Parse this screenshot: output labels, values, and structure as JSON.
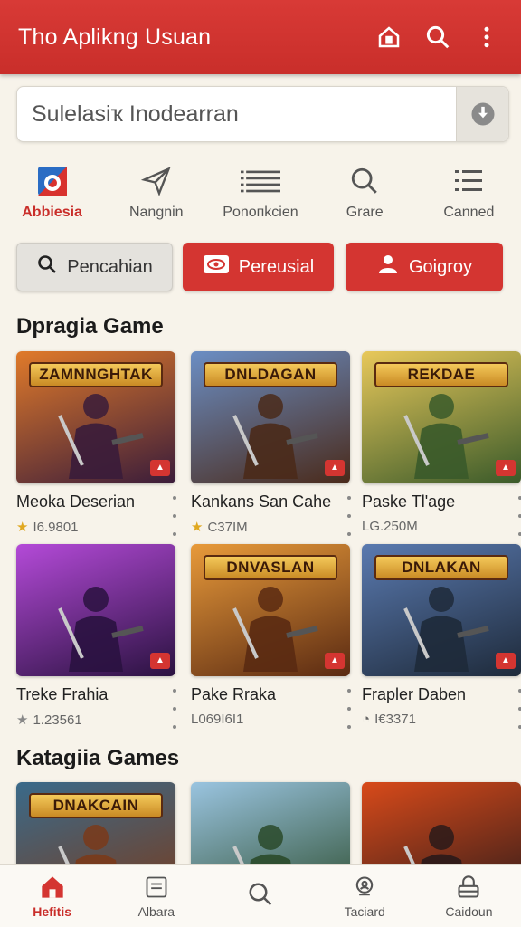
{
  "app": {
    "title": "Tho Aplikng Usuan"
  },
  "header_icons": [
    "home-icon",
    "search-icon",
    "more-vertical-icon"
  ],
  "search": {
    "text": "Sulelasiҡ Inodearran",
    "action_icon": "download-icon"
  },
  "categories": [
    {
      "label": "Abbiesia",
      "icon": "app-logo-icon",
      "active": true
    },
    {
      "label": "Nangnin",
      "icon": "send-icon",
      "active": false
    },
    {
      "label": "Ponoпkcien",
      "icon": "list-icon",
      "active": false
    },
    {
      "label": "Grare",
      "icon": "search-icon",
      "active": false
    },
    {
      "label": "Canned",
      "icon": "menu-list-icon",
      "active": false
    }
  ],
  "chips": [
    {
      "label": "Pencahian",
      "icon": "search-icon"
    },
    {
      "label": "Pereusial",
      "icon": "eye-icon"
    },
    {
      "label": "Goigroy",
      "icon": "user-icon"
    }
  ],
  "sections": {
    "first": "Dpragia Game",
    "second": "Katagiia Games"
  },
  "games": [
    {
      "name": "Meoka Deserian",
      "meta": "I6.9801",
      "meta_icon": "star-icon",
      "banner": "ZAMNNGHTAK",
      "c1": "#e07a2a",
      "c2": "#3a1c3a"
    },
    {
      "name": "Kankans San Cahe",
      "meta": "C37IM",
      "meta_icon": "star-icon",
      "banner": "DNLDAGAN",
      "c1": "#6b8ec4",
      "c2": "#4a2a1a"
    },
    {
      "name": "Paske Tl'age",
      "meta": "LG.250M",
      "meta_icon": "",
      "banner": "REKDAE",
      "c1": "#e8c85a",
      "c2": "#3a5a2a"
    },
    {
      "name": "Treke Frahia",
      "meta": "1.23561",
      "meta_icon": "star-icon",
      "banner": "",
      "c1": "#b44ad8",
      "c2": "#2a1240"
    },
    {
      "name": "Pake Rraka",
      "meta": "L069I6I1",
      "meta_icon": "",
      "banner": "DNVASLAN",
      "c1": "#e89a3a",
      "c2": "#5a2a12"
    },
    {
      "name": "Frapler Daben",
      "meta": "I€3371",
      "meta_icon": "clock-icon",
      "banner": "DNLAKAN",
      "c1": "#5a7ab0",
      "c2": "#1e2a3a"
    }
  ],
  "games2": [
    {
      "banner": "DNAKCAIN",
      "c1": "#3a6a8a",
      "c2": "#7a3a1a"
    },
    {
      "banner": "",
      "c1": "#9ac4e0",
      "c2": "#2a4a2a"
    },
    {
      "banner": "",
      "c1": "#d84a1a",
      "c2": "#2a1a1a"
    }
  ],
  "bottom_nav": [
    {
      "label": "Hefitis",
      "icon": "home-icon",
      "active": true
    },
    {
      "label": "Albara",
      "icon": "document-icon",
      "active": false
    },
    {
      "label": "",
      "icon": "search-icon",
      "active": false
    },
    {
      "label": "Taciard",
      "icon": "search-person-icon",
      "active": false
    },
    {
      "label": "Caidoun",
      "icon": "lock-icon",
      "active": false
    }
  ],
  "colors": {
    "brand": "#c92e2a",
    "background": "#f7f3ea"
  }
}
